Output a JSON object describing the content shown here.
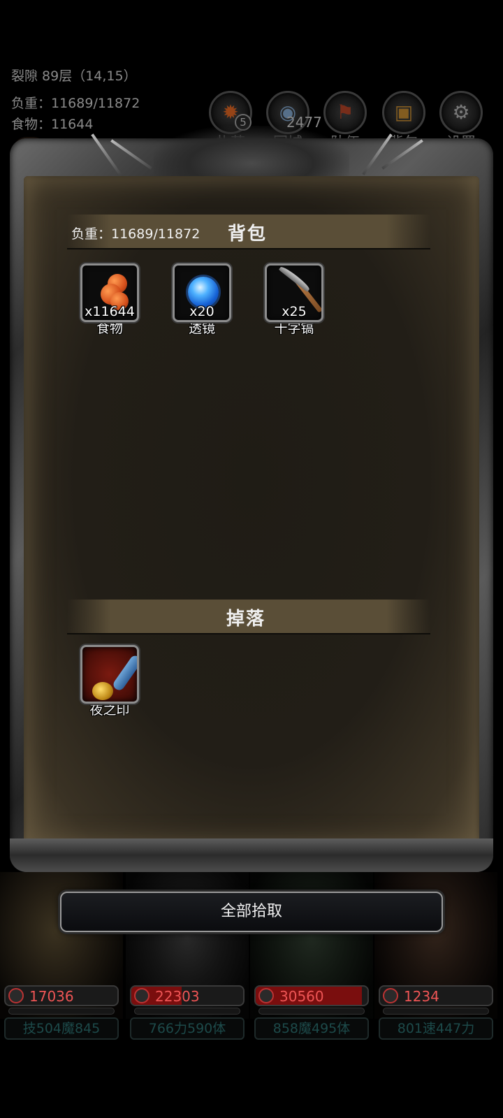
{
  "hud": {
    "floor": "裂隙 89层（14,15）",
    "weight": "负重：11689/11872",
    "food": "食物：11644",
    "count_overlay": "2477"
  },
  "menu": [
    {
      "label": "扎营",
      "icon": "campfire-icon",
      "badge": "5"
    },
    {
      "label": "回城",
      "icon": "portal-icon"
    },
    {
      "label": "队伍",
      "icon": "team-icon"
    },
    {
      "label": "背包",
      "icon": "backpack-icon"
    },
    {
      "label": "设置",
      "icon": "gear-icon"
    }
  ],
  "bag": {
    "title": "背包",
    "weight": "负重：11689/11872",
    "items": [
      {
        "name": "食物",
        "qty": "x11644",
        "icon": "food-icon"
      },
      {
        "name": "透镜",
        "qty": "x20",
        "icon": "lens-icon"
      },
      {
        "name": "十字镐",
        "qty": "x25",
        "icon": "pickaxe-icon"
      }
    ]
  },
  "drop": {
    "title": "掉落",
    "items": [
      {
        "name": "夜之印",
        "icon": "seal-icon"
      }
    ]
  },
  "pick_all_label": "全部拾取",
  "heroes": [
    {
      "hp": "17036",
      "hp_fill": 0.0,
      "stats": "技504魔845"
    },
    {
      "hp": "22303",
      "hp_fill": 0.45,
      "stats": "766力590体"
    },
    {
      "hp": "30560",
      "hp_fill": 0.95,
      "stats": "858魔495体"
    },
    {
      "hp": "1234",
      "hp_fill": 0.0,
      "stats": "801速447力"
    }
  ],
  "colors": {
    "panel_bg": "#221e17",
    "header_band": "#5a4e37",
    "hp_red": "#7a0e0e",
    "hp_text": "#ee5555"
  }
}
